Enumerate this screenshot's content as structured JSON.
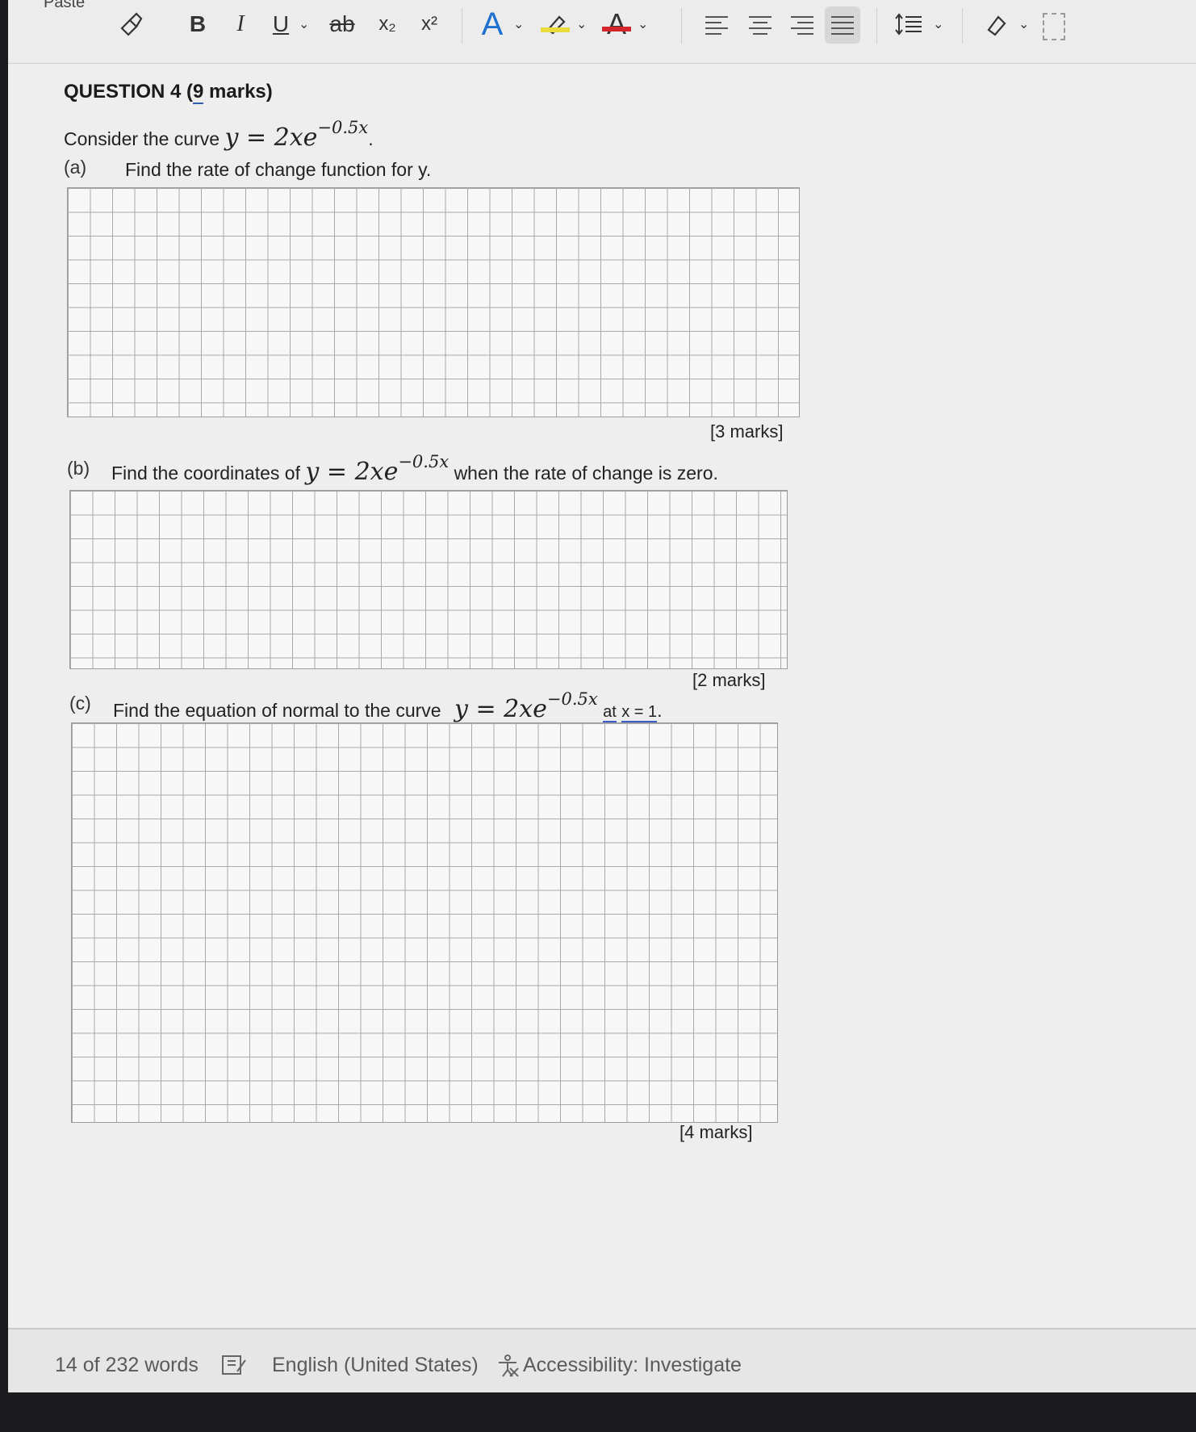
{
  "ribbon": {
    "paste_label": "Paste",
    "bold_label": "B",
    "italic_label": "I",
    "underline_label": "U",
    "strike_label": "ab",
    "subscript_label": "x₂",
    "superscript_label": "x²",
    "font_color_label": "A",
    "text_color_label": "A",
    "icons": [
      "format-painter-icon",
      "chevron-down-icon",
      "highlighter-icon",
      "align-left-icon",
      "align-center-icon",
      "align-right-icon",
      "justify-icon",
      "line-spacing-icon",
      "styles-icon"
    ],
    "colors": {
      "font_effect": "#1f6fd1",
      "highlight": "#e9dc3a",
      "text_color": "#d7262b"
    }
  },
  "document": {
    "question_title_prefix": "QUESTION 4 (",
    "question_title_marks": "9",
    "question_title_suffix": " marks)",
    "intro_text": "Consider the curve",
    "equation_lhs": "y",
    "equation_eq": "=",
    "equation_rhs": "2xe",
    "equation_exp": "−0.5x",
    "part_a": {
      "label": "(a)",
      "text": "Find the rate of change function for y.",
      "marks": "[3 marks]"
    },
    "part_b": {
      "label": "(b)",
      "text_before": "Find the coordinates of",
      "text_after": "when the rate of change is zero.",
      "marks": "[2 marks]"
    },
    "part_c": {
      "label": "(c)",
      "text_before": "Find the equation of normal to the curve",
      "text_at": "at",
      "text_x": "x = 1",
      "marks": "[4 marks]"
    },
    "highlight_color": "#f2b8d4"
  },
  "status_bar": {
    "word_count": "14 of 232 words",
    "language": "English (United States)",
    "accessibility": "Accessibility: Investigate",
    "icons": [
      "proofing-icon",
      "accessibility-icon"
    ]
  }
}
